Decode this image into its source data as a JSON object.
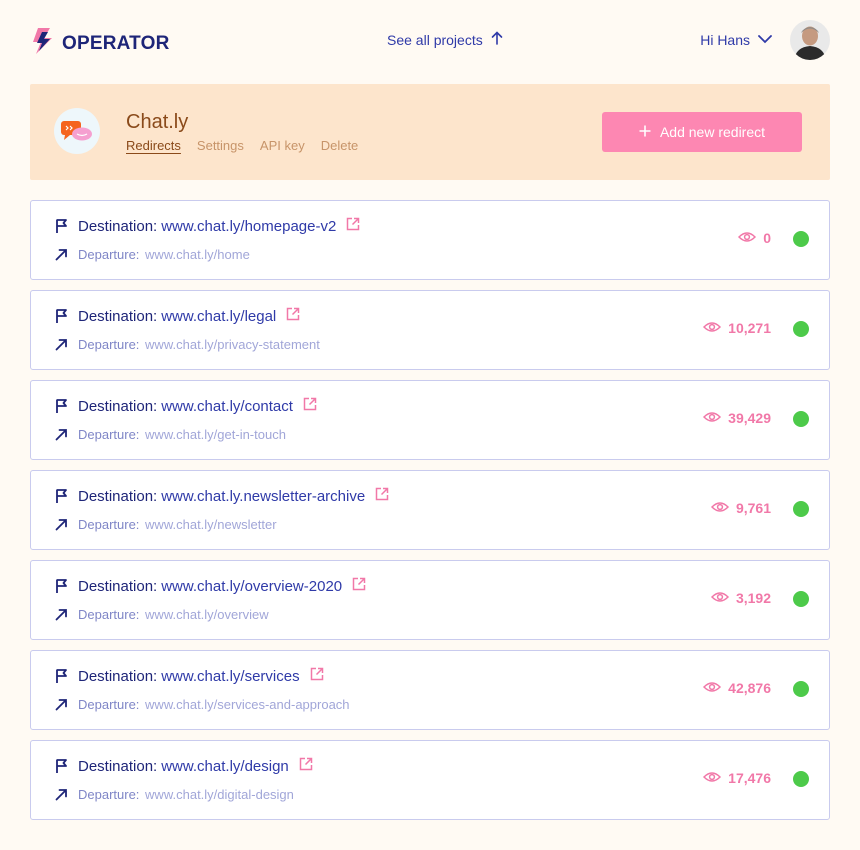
{
  "header": {
    "brand": "OPERATOR",
    "see_all": "See all projects",
    "greeting": "Hi Hans"
  },
  "project": {
    "name": "Chat.ly",
    "tabs": [
      "Redirects",
      "Settings",
      "API key",
      "Delete"
    ],
    "active_tab": "Redirects",
    "add_button": "Add new redirect"
  },
  "labels": {
    "destination": "Destination:",
    "departure": "Departure:"
  },
  "redirects": [
    {
      "destination": "www.chat.ly/homepage-v2",
      "departure": "www.chat.ly/home",
      "views": "0",
      "status": "active"
    },
    {
      "destination": "www.chat.ly/legal",
      "departure": "www.chat.ly/privacy-statement",
      "views": "10,271",
      "status": "active"
    },
    {
      "destination": "www.chat.ly/contact",
      "departure": "www.chat.ly/get-in-touch",
      "views": "39,429",
      "status": "active"
    },
    {
      "destination": "www.chat.ly.newsletter-archive",
      "departure": "www.chat.ly/newsletter",
      "views": "9,761",
      "status": "active"
    },
    {
      "destination": "www.chat.ly/overview-2020",
      "departure": "www.chat.ly/overview",
      "views": "3,192",
      "status": "active"
    },
    {
      "destination": "www.chat.ly/services",
      "departure": "www.chat.ly/services-and-approach",
      "views": "42,876",
      "status": "active"
    },
    {
      "destination": "www.chat.ly/design",
      "departure": "www.chat.ly/digital-design",
      "views": "17,476",
      "status": "active"
    }
  ],
  "icons": {
    "brand": "operator-logo-icon",
    "see_all": "arrow-up-icon",
    "user_menu": "chevron-down-icon",
    "project": "chat-bubbles-icon",
    "add": "plus-icon",
    "destination": "flag-icon",
    "departure": "arrow-up-right-icon",
    "external": "external-link-icon",
    "views": "eye-icon",
    "status": "status-dot"
  },
  "colors": {
    "background": "#fffaf3",
    "navy": "#1e2578",
    "link": "#2f3aa8",
    "accent_pink": "#fd87b2",
    "views_pink": "#f178a8",
    "project_panel": "#fde5cc",
    "project_text": "#8a4a1a",
    "status_active": "#4dca4a",
    "card_border": "#c9cbee"
  }
}
